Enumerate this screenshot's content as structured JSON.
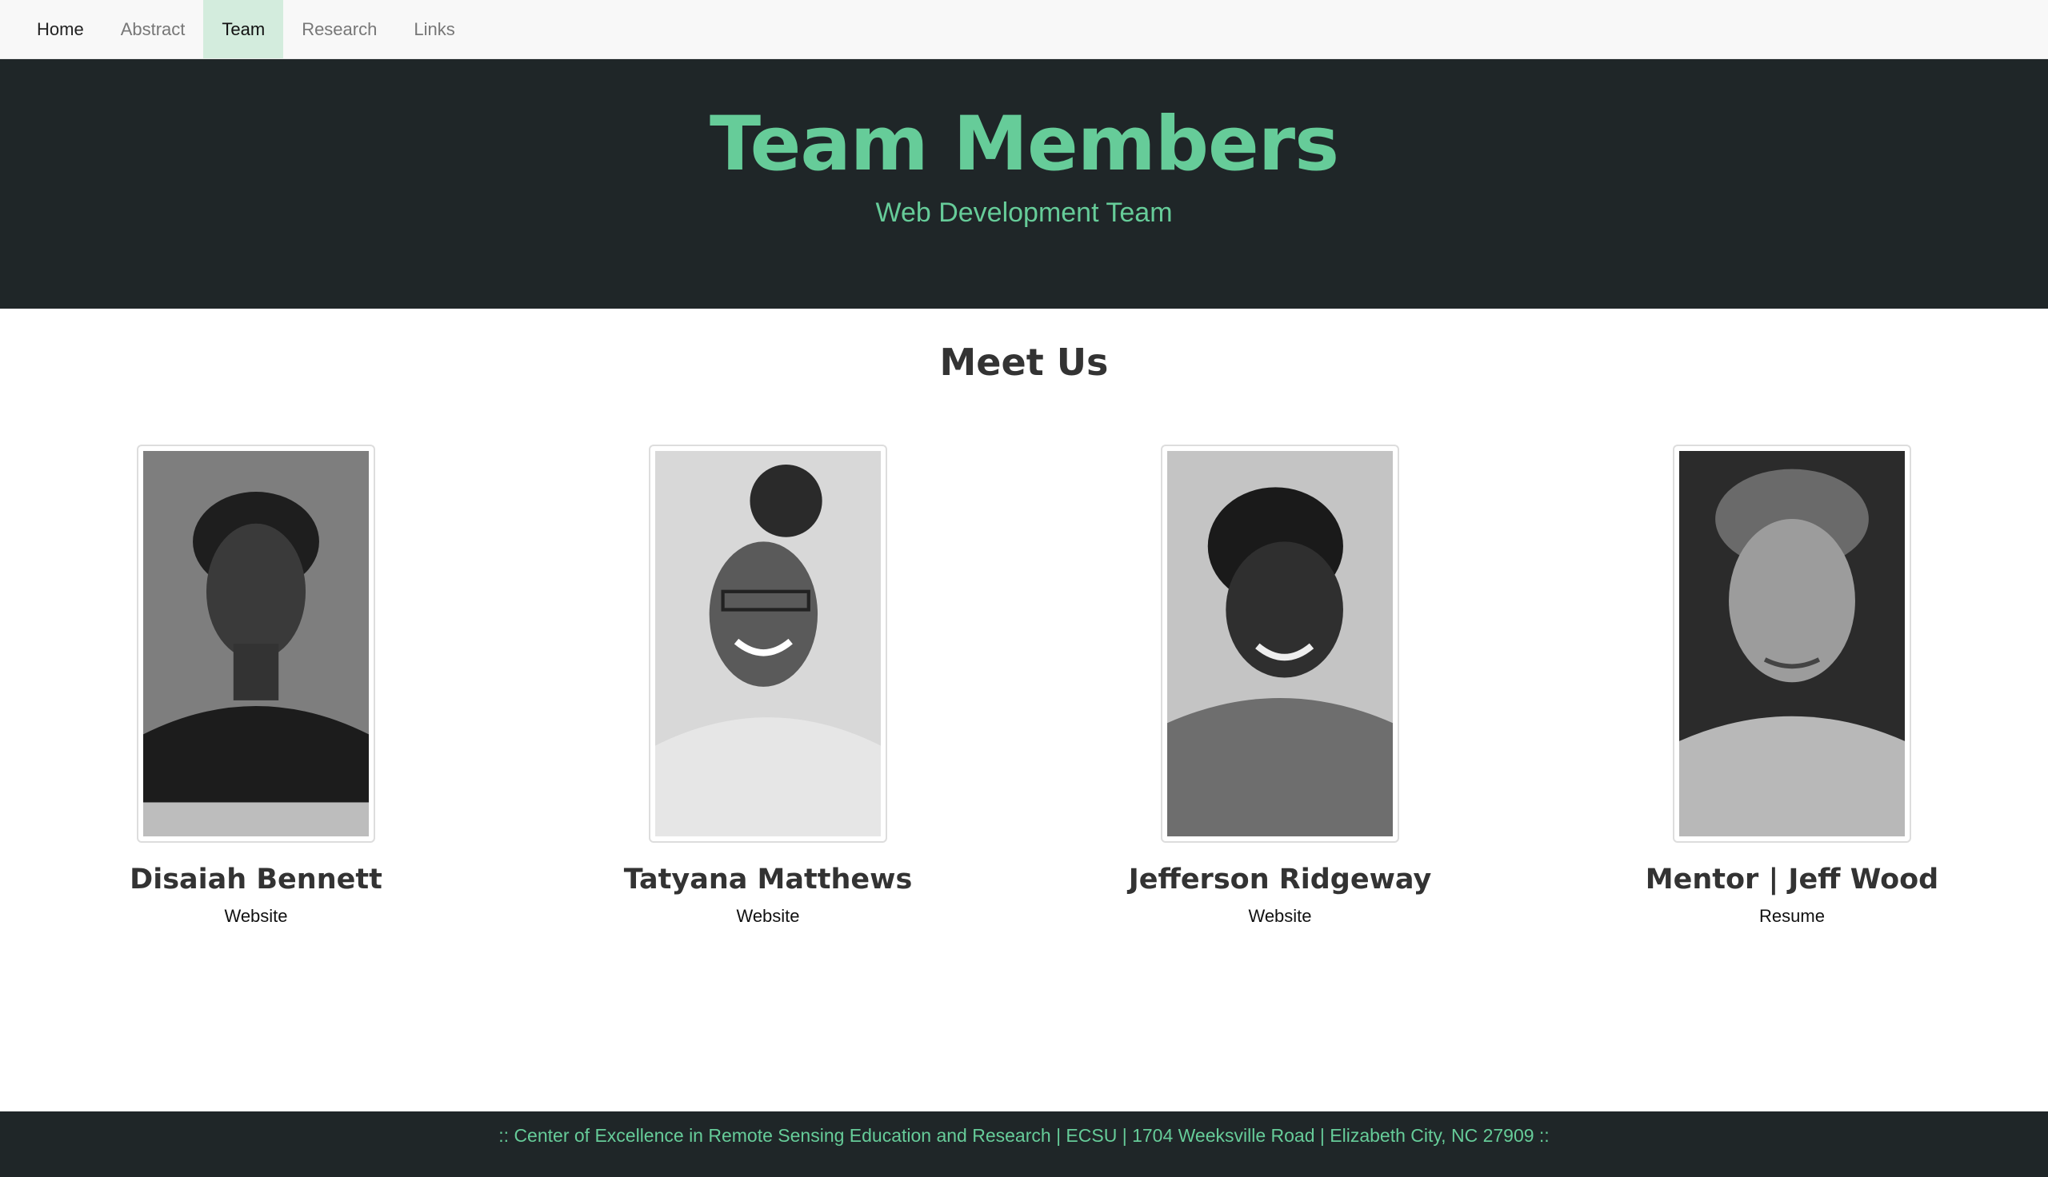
{
  "nav": {
    "items": [
      {
        "label": "Home"
      },
      {
        "label": "Abstract"
      },
      {
        "label": "Team"
      },
      {
        "label": "Research"
      },
      {
        "label": "Links"
      }
    ],
    "active": "Team"
  },
  "hero": {
    "title": "Team Members",
    "subtitle": "Web Development Team"
  },
  "section": {
    "title": "Meet Us"
  },
  "members": [
    {
      "name": "Disaiah Bennett",
      "link": "Website"
    },
    {
      "name": "Tatyana Matthews",
      "link": "Website"
    },
    {
      "name": "Jefferson Ridgeway",
      "link": "Website"
    },
    {
      "name": "Mentor | Jeff Wood",
      "link": "Resume"
    }
  ],
  "footer": {
    "text": ":: Center of Excellence in Remote Sensing Education and Research | ECSU | 1704 Weeksville Road | Elizabeth City, NC 27909 ::"
  },
  "colors": {
    "accent": "#66cc99",
    "dark_bg": "#1f2628",
    "nav_active_bg": "#d3ecdd"
  }
}
